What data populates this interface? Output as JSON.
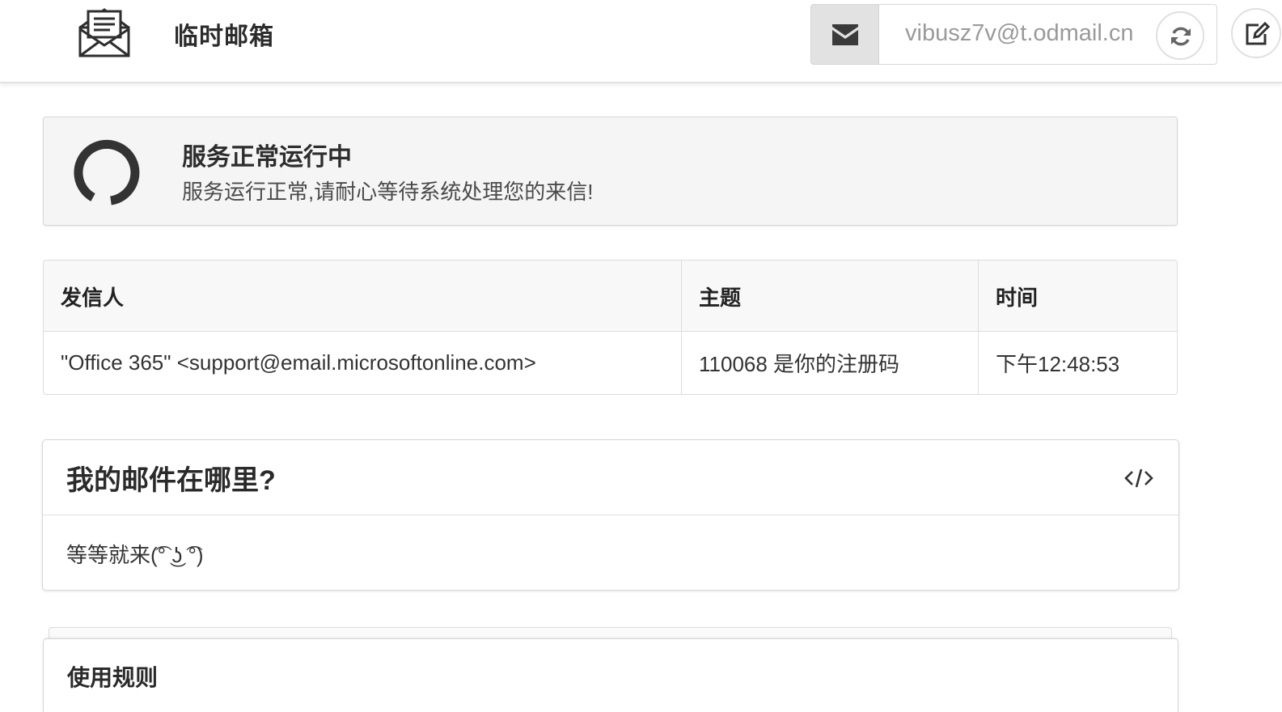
{
  "header": {
    "brand_title": "临时邮箱",
    "logo_icon": "envelope-letter-icon",
    "mail_addon_icon": "envelope-icon",
    "email_address": "vibusz7v@t.odmail.cn",
    "refresh_icon": "refresh-icon",
    "edit_icon": "edit-icon"
  },
  "status": {
    "icon": "spinner-icon",
    "title": "服务正常运行中",
    "description": "服务运行正常,请耐心等待系统处理您的来信!"
  },
  "inbox": {
    "columns": [
      "发信人",
      "主题",
      "时间"
    ],
    "rows": [
      {
        "sender": "\"Office 365\" <support@email.microsoftonline.com>",
        "subject": "110068 是你的注册码",
        "time": "下午12:48:53"
      }
    ]
  },
  "faq": {
    "title": "我的邮件在哪里?",
    "toggle_icon": "code-icon",
    "body": "等等就来(͡° ͜ʖ ͡°)"
  },
  "rules": {
    "title": "使用规则"
  },
  "colors": {
    "navbar_bg": "#ffffff",
    "addon_bg": "#e2e2e2",
    "status_bg": "#f5f5f5",
    "table_head_bg": "#f8f8f8",
    "icon_dark": "#333333",
    "border": "#d6d6d6"
  }
}
